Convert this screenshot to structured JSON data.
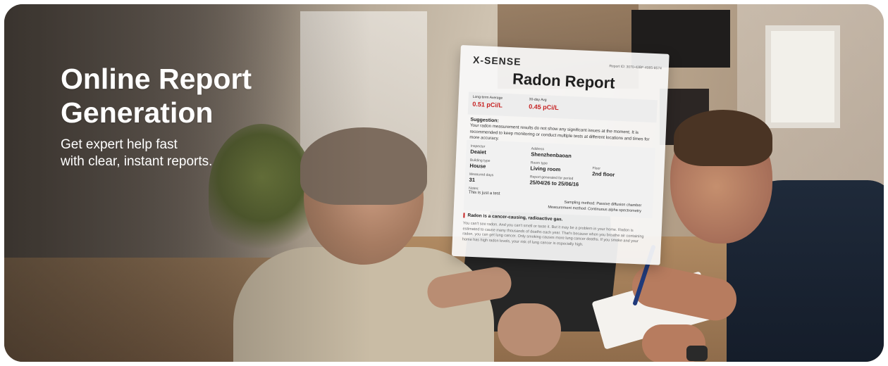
{
  "hero": {
    "title_line1": "Online Report",
    "title_line2": "Generation",
    "subtitle_line1": "Get expert help fast",
    "subtitle_line2": "with clear, instant reports."
  },
  "report": {
    "brand": "X-SENSE",
    "report_id": "Report ID: 3070-43BF-4085-8574",
    "title": "Radon Report",
    "long_term_label": "Long-term Average",
    "long_term_value": "0.51 pCi/L",
    "day30_label": "30-day Avg",
    "day30_value": "0.45 pCi/L",
    "suggestion_heading": "Suggestion:",
    "suggestion_text": "Your radon measurement results do not show any significant issues at the moment. It is recommended to keep monitoring or conduct multiple tests at different locations and times for more accuracy.",
    "inspector_label": "Inspector",
    "inspector_value": "Deaiet",
    "address_label": "Address",
    "address_value": "Shenzhenbaoan",
    "building_label": "Building type",
    "building_value": "House",
    "room_label": "Room type",
    "room_value": "Living room",
    "floor_label": "Floor",
    "floor_value": "2nd floor",
    "measured_label": "Measured days",
    "measured_value": "31",
    "period_label": "Report generated for period",
    "period_value": "25/04/26 to 25/06/16",
    "notes_label": "Notes:",
    "notes_value": "This is just a test",
    "sampling_method": "Sampling method: Passive diffusion chamber",
    "measurement_method": "Measurement method: Continuous alpha spectrometry",
    "warning_heading": "Radon is a cancer-causing, radioactive gas.",
    "warning_text": "You can't see radon. And you can't smell or taste it. But it may be a problem in your home. Radon is estimated to cause many thousands of deaths each year. That's because when you breathe air containing radon, you can get lung cancer. Only smoking causes more lung cancer deaths. If you smoke and your home has high radon levels, your risk of lung cancer is especially high."
  }
}
